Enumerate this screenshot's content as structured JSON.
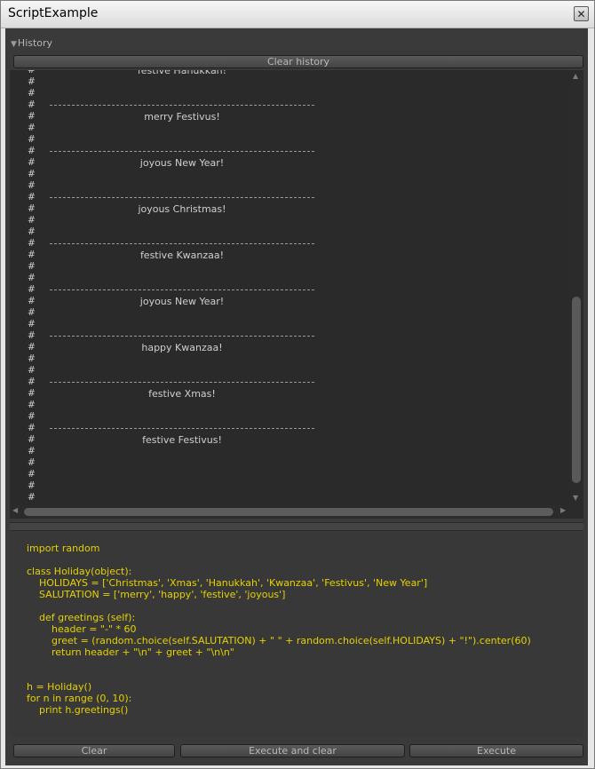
{
  "window": {
    "title": "ScriptExample"
  },
  "history": {
    "header_label": "History",
    "clear_label": "Clear history",
    "top_partial_message": "festive Hanukkah!",
    "messages": [
      "merry Festivus!",
      "joyous New Year!",
      "joyous Christmas!",
      "festive Kwanzaa!",
      "joyous New Year!",
      "happy Kwanzaa!",
      "festive Xmas!",
      "festive Festivus!"
    ]
  },
  "code": {
    "lines": [
      "import random",
      "",
      "class Holiday(object):",
      "    HOLIDAYS = ['Christmas', 'Xmas', 'Hanukkah', 'Kwanzaa', 'Festivus', 'New Year']",
      "    SALUTATION = ['merry', 'happy', 'festive', 'joyous']",
      "",
      "    def greetings (self):",
      "        header = \"-\" * 60",
      "        greet = (random.choice(self.SALUTATION) + \" \" + random.choice(self.HOLIDAYS) + \"!\").center(60)",
      "        return header + \"\\n\" + greet + \"\\n\\n\"",
      "",
      "",
      "h = Holiday()",
      "for n in range (0, 10):",
      "    print h.greetings()"
    ]
  },
  "buttons": {
    "clear": "Clear",
    "execute_and_clear": "Execute and clear",
    "execute": "Execute"
  }
}
